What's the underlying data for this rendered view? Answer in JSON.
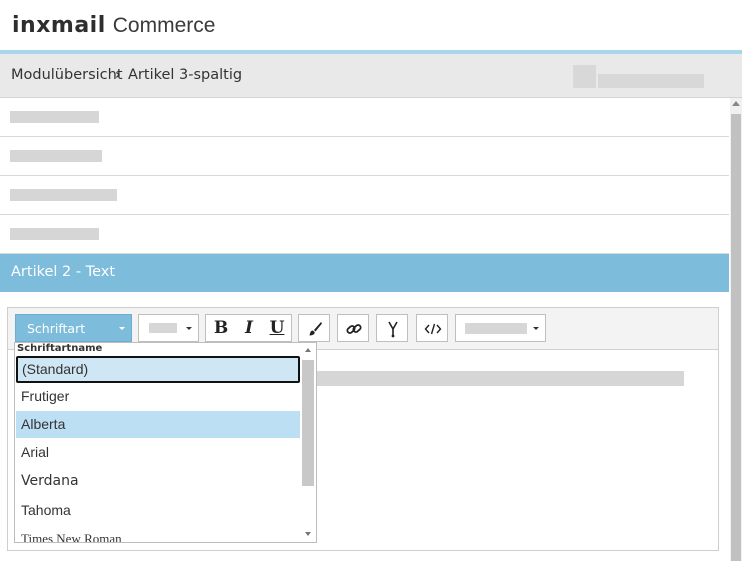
{
  "header": {
    "logo_mark": "inxmail",
    "logo_word": "Commerce"
  },
  "breadcrumb": {
    "items": [
      "Modulübersicht",
      "Artikel 3-spaltig"
    ],
    "separator": "›"
  },
  "section": {
    "title": "Artikel 2 - Text"
  },
  "toolbar": {
    "font_button_label": "Schriftart",
    "bold_label": "B",
    "italic_label": "I",
    "underline_label": "U"
  },
  "font_dropdown": {
    "header": "Schriftartname",
    "options": [
      {
        "label": "(Standard)",
        "state": "selected"
      },
      {
        "label": "Frutiger",
        "state": ""
      },
      {
        "label": "Alberta",
        "state": "hover"
      },
      {
        "label": "Arial",
        "state": ""
      },
      {
        "label": "Verdana",
        "state": ""
      },
      {
        "label": "Tahoma",
        "state": ""
      },
      {
        "label": "Times New Roman",
        "state": ""
      }
    ]
  },
  "colors": {
    "accent": "#7dbcdb",
    "accent_line": "#a9d7ea",
    "selection": "#bddff3"
  }
}
